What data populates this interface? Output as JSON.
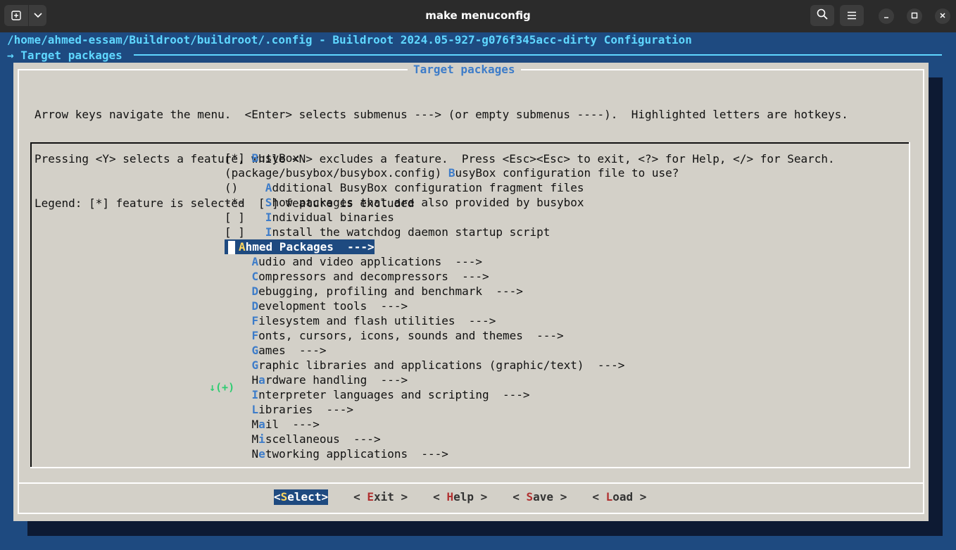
{
  "window": {
    "title": "make menuconfig"
  },
  "terminal": {
    "config_path": "/home/ahmed-essam/Buildroot/buildroot/.config - Buildroot 2024.05-927-g076f345acc-dirty Configuration",
    "breadcrumb": "→ Target packages"
  },
  "dialog": {
    "title": "Target packages",
    "help_lines": [
      "Arrow keys navigate the menu.  <Enter> selects submenus ---> (or empty submenus ----).  Highlighted letters are hotkeys.",
      "Pressing <Y> selects a feature, while <N> excludes a feature.  Press <Esc><Esc> to exit, <?> for Help, </> for Search.",
      "Legend: [*] feature is selected  [ ] feature is excluded"
    ],
    "more_indicator": "↓(+)"
  },
  "menu": {
    "items": [
      {
        "prefix": "[*] ",
        "hotkey": "B",
        "rest": "usyBox",
        "suffix": ""
      },
      {
        "prefix": "(package/busybox/busybox.config) ",
        "hotkey": "B",
        "rest": "usyBox configuration file to use?",
        "suffix": ""
      },
      {
        "prefix": "()    ",
        "hotkey": "A",
        "rest": "dditional BusyBox configuration fragment files",
        "suffix": ""
      },
      {
        "prefix": "-*-   ",
        "hotkey": "S",
        "rest": "how packages that are also provided by busybox",
        "suffix": ""
      },
      {
        "prefix": "[ ]   ",
        "hotkey": "I",
        "rest": "ndividual binaries",
        "suffix": ""
      },
      {
        "prefix": "[ ]   ",
        "hotkey": "I",
        "rest": "nstall the watchdog daemon startup script",
        "suffix": ""
      },
      {
        "prefix": "",
        "hotkey": "A",
        "rest": "hmed Packages  --->",
        "suffix": "",
        "selected": true
      },
      {
        "prefix": "    ",
        "hotkey": "A",
        "rest": "udio and video applications  --->",
        "suffix": ""
      },
      {
        "prefix": "    ",
        "hotkey": "C",
        "rest": "ompressors and decompressors  --->",
        "suffix": ""
      },
      {
        "prefix": "    ",
        "hotkey": "D",
        "rest": "ebugging, profiling and benchmark  --->",
        "suffix": ""
      },
      {
        "prefix": "    ",
        "hotkey": "D",
        "rest": "evelopment tools  --->",
        "suffix": ""
      },
      {
        "prefix": "    ",
        "hotkey": "F",
        "rest": "ilesystem and flash utilities  --->",
        "suffix": ""
      },
      {
        "prefix": "    ",
        "hotkey": "F",
        "rest": "onts, cursors, icons, sounds and themes  --->",
        "suffix": ""
      },
      {
        "prefix": "    ",
        "hotkey": "G",
        "rest": "ames  --->",
        "suffix": ""
      },
      {
        "prefix": "    ",
        "hotkey": "G",
        "rest": "raphic libraries and applications (graphic/text)  --->",
        "suffix": ""
      },
      {
        "prefix": "    H",
        "hotkey": "a",
        "rest": "rdware handling  --->",
        "suffix": ""
      },
      {
        "prefix": "    ",
        "hotkey": "I",
        "rest": "nterpreter languages and scripting  --->",
        "suffix": ""
      },
      {
        "prefix": "    ",
        "hotkey": "L",
        "rest": "ibraries  --->",
        "suffix": ""
      },
      {
        "prefix": "    M",
        "hotkey": "a",
        "rest": "il  --->",
        "suffix": ""
      },
      {
        "prefix": "    M",
        "hotkey": "i",
        "rest": "scellaneous  --->",
        "suffix": ""
      },
      {
        "prefix": "    N",
        "hotkey": "e",
        "rest": "tworking applications  --->",
        "suffix": ""
      }
    ]
  },
  "buttons": [
    {
      "open": "<",
      "hotkey": "S",
      "rest": "elect",
      "close": ">",
      "active": true
    },
    {
      "open": "< ",
      "hotkey": "E",
      "rest": "xit",
      "close": " >"
    },
    {
      "open": "< ",
      "hotkey": "H",
      "rest": "elp",
      "close": " >"
    },
    {
      "open": "< ",
      "hotkey": "S",
      "rest": "ave",
      "close": " >"
    },
    {
      "open": "< ",
      "hotkey": "L",
      "rest": "oad",
      "close": " >"
    }
  ],
  "colors": {
    "terminal_bg": "#1e4a80",
    "dialog_bg": "#d3d0c8",
    "hotkey": "#3d7cc9",
    "accent_text": "#5fd7ff",
    "selected_bg": "#1e4a80",
    "selected_hotkey": "#ffd75f",
    "button_hotkey": "#b03030"
  }
}
